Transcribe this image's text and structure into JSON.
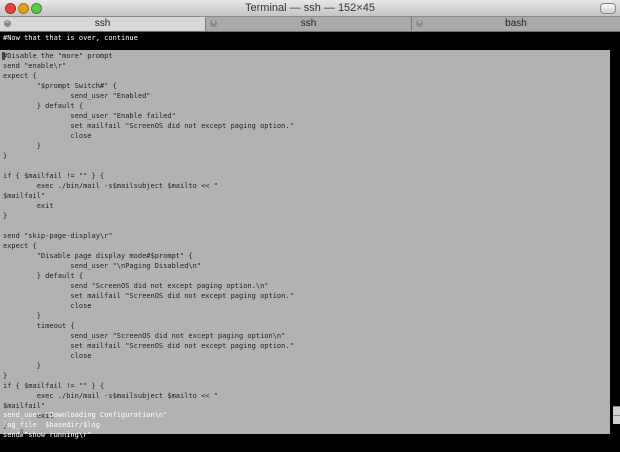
{
  "window": {
    "title": "Terminal — ssh — 152×45",
    "tabs": [
      {
        "label": "ssh",
        "close": "×"
      },
      {
        "label": "ssh",
        "close": "×"
      },
      {
        "label": "bash",
        "close": "×"
      }
    ]
  },
  "terminal": {
    "header_line": "#Now that that is over, continue",
    "selected_lines": [
      "#Disable the \"more\" prompt",
      "send \"enable\\r\"",
      "expect {",
      "        \"$prompt Switch#\" {",
      "                send_user \"Enabled\"",
      "        } default {",
      "                send_user \"Enable failed\"",
      "                set mailfail \"ScreenOS did not except paging option.\"",
      "                close",
      "        }",
      "}",
      "",
      "if { $mailfail != \"\" } {",
      "        exec ./bin/mail -s$mailsubject $mailto << \"",
      "$mailfail\"",
      "        exit",
      "}",
      "",
      "send \"skip-page-display\\r\"",
      "expect {",
      "        \"Disable page display mode#$prompt\" {",
      "                send_user \"\\nPaging Disabled\\n\"",
      "        } default {",
      "                send \"ScreenOS did not except paging option.\\n\"",
      "                set mailfail \"ScreenOS did not except paging option.\"",
      "                close",
      "        }",
      "        timeout {",
      "                send_user \"ScreenOS did not except paging option\\n\"",
      "                set mailfail \"ScreenOS did not except paging option.\"",
      "                close",
      "        }",
      "}",
      "if { $mailfail != \"\" } {",
      "        exec ./bin/mail -s$mailsubject $mailto << \"",
      "$mailfail\"",
      "        exit",
      "}"
    ],
    "footer_lines": [
      "send_user \"Downloading Configuration\\n\"",
      "log_file  $basedir/$log",
      "send \"show running\\r\""
    ]
  },
  "colors": {
    "background": "#000000",
    "selection": "#b2b2b2",
    "text": "#ffffff"
  }
}
